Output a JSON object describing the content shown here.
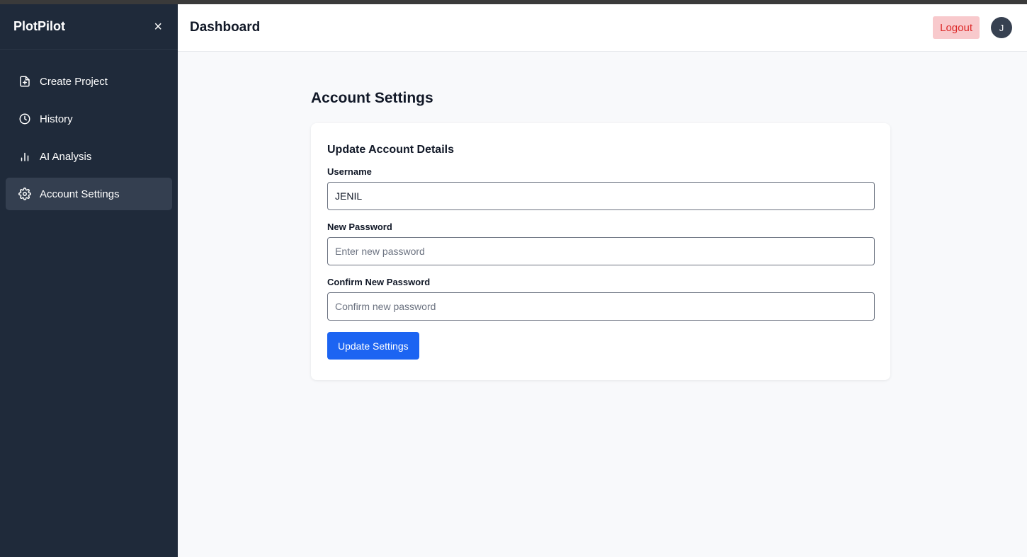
{
  "app": {
    "brand": "PlotPilot",
    "close_glyph": "×"
  },
  "sidebar": {
    "items": [
      {
        "label": "Create Project",
        "icon": "file-plus-icon",
        "active": false
      },
      {
        "label": "History",
        "icon": "clock-icon",
        "active": false
      },
      {
        "label": "AI Analysis",
        "icon": "bar-chart-icon",
        "active": false
      },
      {
        "label": "Account Settings",
        "icon": "gear-icon",
        "active": true
      }
    ]
  },
  "header": {
    "title": "Dashboard",
    "logout_label": "Logout",
    "avatar_initial": "J"
  },
  "main": {
    "page_title": "Account Settings",
    "card": {
      "title": "Update Account Details",
      "username": {
        "label": "Username",
        "value": "JENIL"
      },
      "new_password": {
        "label": "New Password",
        "placeholder": "Enter new password"
      },
      "confirm_password": {
        "label": "Confirm New Password",
        "placeholder": "Confirm new password"
      },
      "submit_label": "Update Settings"
    }
  },
  "colors": {
    "sidebar_bg": "#1f2a3a",
    "active_item_bg": "#343f50",
    "primary": "#1c64f2",
    "logout_bg": "#f8c9cc",
    "logout_text": "#dc2626"
  }
}
